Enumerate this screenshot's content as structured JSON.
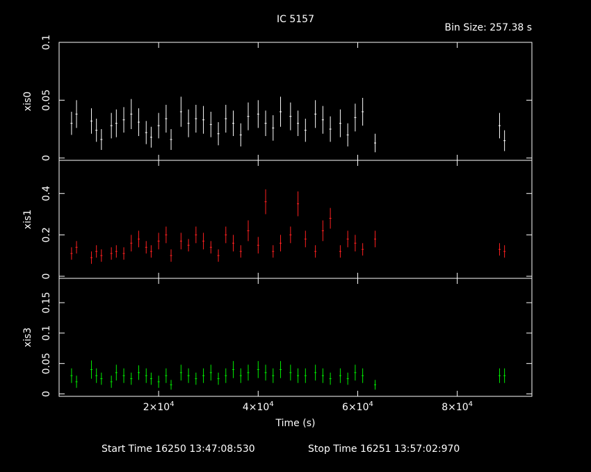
{
  "header": {
    "title": "IC 5157",
    "bin_size": "Bin Size: 257.38 s"
  },
  "footer": {
    "start": "Start Time 16250 13:47:08:530",
    "stop": "Stop Time 16251 13:57:02:970"
  },
  "chart_data": {
    "type": "scatter",
    "xlabel": "Time (s)",
    "xlim": [
      0,
      95000
    ],
    "x_ticks": [
      {
        "value": 20000,
        "mantissa": "2",
        "exponent": "4"
      },
      {
        "value": 40000,
        "mantissa": "4",
        "exponent": "4"
      },
      {
        "value": 60000,
        "mantissa": "6",
        "exponent": "4"
      },
      {
        "value": 80000,
        "mantissa": "8",
        "exponent": "4"
      }
    ],
    "panels": [
      {
        "ylabel": "xis0",
        "color": "#ffffff",
        "ylim": [
          -0.002,
          0.1
        ],
        "yticks": [
          {
            "value": 0,
            "label": "0"
          },
          {
            "value": 0.05,
            "label": "0.05"
          },
          {
            "value": 0.1,
            "label": "0.1"
          }
        ],
        "x": [
          2500,
          3500,
          6500,
          7500,
          8500,
          10500,
          11500,
          13000,
          14500,
          16000,
          17500,
          18500,
          20000,
          21500,
          22500,
          24500,
          26000,
          27500,
          29000,
          30500,
          32000,
          33500,
          35000,
          36500,
          38000,
          40000,
          41500,
          43000,
          44500,
          46500,
          48000,
          49500,
          51500,
          53000,
          54500,
          56500,
          58000,
          59500,
          61000,
          63500,
          88500,
          89500
        ],
        "y": [
          0.03,
          0.038,
          0.032,
          0.024,
          0.016,
          0.028,
          0.03,
          0.033,
          0.038,
          0.031,
          0.022,
          0.018,
          0.028,
          0.034,
          0.016,
          0.04,
          0.03,
          0.034,
          0.033,
          0.029,
          0.021,
          0.034,
          0.03,
          0.02,
          0.036,
          0.038,
          0.03,
          0.026,
          0.04,
          0.036,
          0.03,
          0.024,
          0.038,
          0.033,
          0.025,
          0.03,
          0.02,
          0.035,
          0.04,
          0.013,
          0.028,
          0.015
        ],
        "err": [
          0.01,
          0.012,
          0.011,
          0.01,
          0.009,
          0.011,
          0.012,
          0.011,
          0.013,
          0.012,
          0.01,
          0.009,
          0.011,
          0.012,
          0.009,
          0.013,
          0.012,
          0.012,
          0.012,
          0.011,
          0.01,
          0.012,
          0.011,
          0.01,
          0.012,
          0.012,
          0.011,
          0.011,
          0.013,
          0.012,
          0.011,
          0.01,
          0.012,
          0.012,
          0.011,
          0.012,
          0.01,
          0.012,
          0.012,
          0.008,
          0.011,
          0.009
        ]
      },
      {
        "ylabel": "xis1",
        "color": "#ff2020",
        "ylim": [
          -0.01,
          0.56
        ],
        "yticks": [
          {
            "value": 0,
            "label": "0"
          },
          {
            "value": 0.2,
            "label": "0.2"
          },
          {
            "value": 0.4,
            "label": "0.4"
          }
        ],
        "x": [
          2500,
          3500,
          6500,
          7500,
          8500,
          10500,
          11500,
          13000,
          14500,
          16000,
          17500,
          18500,
          20000,
          21500,
          22500,
          24500,
          26000,
          27500,
          29000,
          30500,
          32000,
          33500,
          35000,
          36500,
          38000,
          40000,
          41500,
          43000,
          44500,
          46500,
          48000,
          49500,
          51500,
          53000,
          54500,
          56500,
          58000,
          59500,
          61000,
          63500,
          88500,
          89500
        ],
        "y": [
          0.11,
          0.14,
          0.09,
          0.12,
          0.1,
          0.11,
          0.12,
          0.11,
          0.16,
          0.18,
          0.14,
          0.12,
          0.17,
          0.2,
          0.1,
          0.17,
          0.15,
          0.2,
          0.17,
          0.14,
          0.1,
          0.2,
          0.16,
          0.12,
          0.22,
          0.15,
          0.36,
          0.12,
          0.16,
          0.2,
          0.35,
          0.18,
          0.12,
          0.22,
          0.28,
          0.12,
          0.18,
          0.16,
          0.13,
          0.18,
          0.13,
          0.12
        ],
        "err": [
          0.03,
          0.03,
          0.03,
          0.03,
          0.03,
          0.03,
          0.03,
          0.03,
          0.04,
          0.04,
          0.03,
          0.03,
          0.04,
          0.04,
          0.03,
          0.04,
          0.03,
          0.04,
          0.04,
          0.03,
          0.03,
          0.04,
          0.04,
          0.03,
          0.05,
          0.04,
          0.06,
          0.03,
          0.04,
          0.04,
          0.06,
          0.04,
          0.03,
          0.05,
          0.05,
          0.03,
          0.04,
          0.04,
          0.03,
          0.04,
          0.03,
          0.03
        ]
      },
      {
        "ylabel": "xis3",
        "color": "#00ee00",
        "ylim": [
          -0.004,
          0.19
        ],
        "yticks": [
          {
            "value": 0,
            "label": "0"
          },
          {
            "value": 0.05,
            "label": "0.05"
          },
          {
            "value": 0.1,
            "label": "0.1"
          },
          {
            "value": 0.15,
            "label": "0.15"
          }
        ],
        "x": [
          2500,
          3500,
          6500,
          7500,
          8500,
          10500,
          11500,
          13000,
          14500,
          16000,
          17500,
          18500,
          20000,
          21500,
          22500,
          24500,
          26000,
          27500,
          29000,
          30500,
          32000,
          33500,
          35000,
          36500,
          38000,
          40000,
          41500,
          43000,
          44500,
          46500,
          48000,
          49500,
          51500,
          53000,
          54500,
          56500,
          58000,
          59500,
          61000,
          63500,
          88500,
          89500
        ],
        "y": [
          0.03,
          0.02,
          0.04,
          0.03,
          0.025,
          0.02,
          0.035,
          0.03,
          0.025,
          0.035,
          0.03,
          0.025,
          0.02,
          0.03,
          0.015,
          0.035,
          0.03,
          0.025,
          0.03,
          0.035,
          0.025,
          0.03,
          0.04,
          0.03,
          0.035,
          0.04,
          0.035,
          0.03,
          0.04,
          0.035,
          0.03,
          0.03,
          0.035,
          0.03,
          0.025,
          0.03,
          0.025,
          0.035,
          0.03,
          0.015,
          0.03,
          0.03
        ],
        "err": [
          0.012,
          0.01,
          0.015,
          0.012,
          0.01,
          0.01,
          0.013,
          0.012,
          0.01,
          0.012,
          0.012,
          0.01,
          0.01,
          0.012,
          0.008,
          0.013,
          0.012,
          0.01,
          0.012,
          0.013,
          0.01,
          0.012,
          0.014,
          0.012,
          0.013,
          0.014,
          0.013,
          0.012,
          0.014,
          0.013,
          0.012,
          0.012,
          0.013,
          0.012,
          0.01,
          0.012,
          0.01,
          0.013,
          0.012,
          0.008,
          0.012,
          0.012
        ]
      }
    ]
  }
}
